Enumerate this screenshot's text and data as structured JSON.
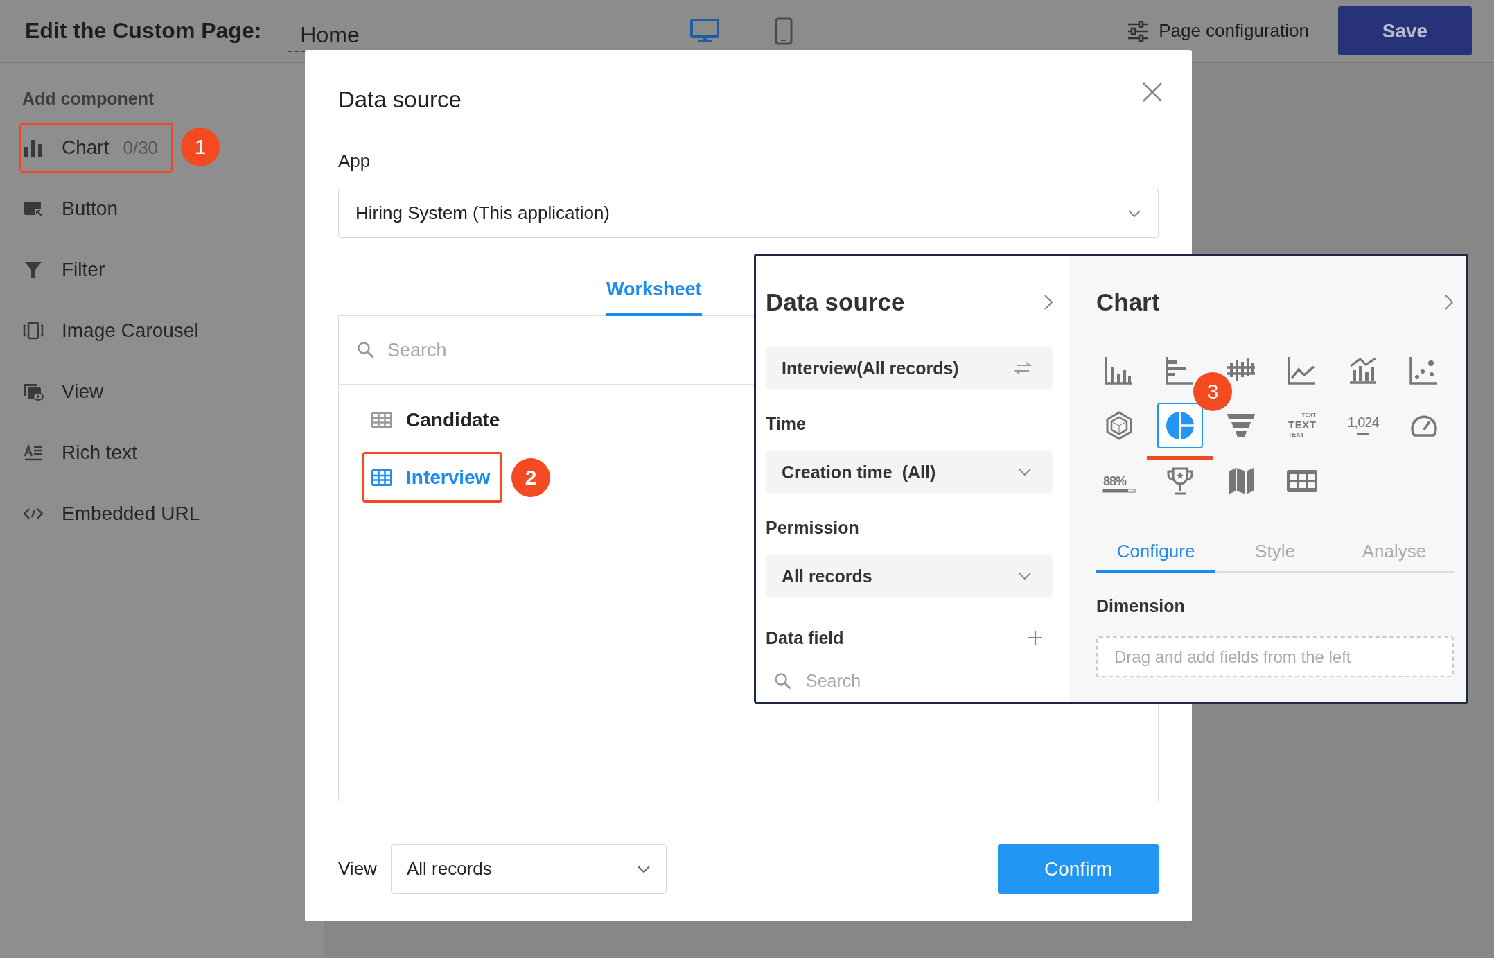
{
  "topbar": {
    "title": "Edit the Custom Page:",
    "page_name": "Home",
    "devices": [
      {
        "kind": "desktop",
        "selected": true
      },
      {
        "kind": "mobile",
        "selected": false
      }
    ],
    "config_label": "Page configuration",
    "save_label": "Save"
  },
  "sidebar": {
    "heading": "Add component",
    "items": [
      {
        "kind": "chart",
        "label": "Chart",
        "count": "0/30",
        "highlighted": true,
        "badge": "1"
      },
      {
        "kind": "button",
        "label": "Button",
        "highlighted": false
      },
      {
        "kind": "filter",
        "label": "Filter",
        "highlighted": false
      },
      {
        "kind": "carousel",
        "label": "Image Carousel",
        "highlighted": false
      },
      {
        "kind": "view",
        "label": "View",
        "highlighted": false
      },
      {
        "kind": "richtext",
        "label": "Rich text",
        "highlighted": false
      },
      {
        "kind": "embed",
        "label": "Embedded URL",
        "highlighted": false
      }
    ]
  },
  "dialog": {
    "title": "Data source",
    "app_label": "App",
    "app_value": "Hiring System (This application)",
    "tabs": [
      {
        "label": "Worksheet",
        "selected": true
      }
    ],
    "search_placeholder": "Search",
    "worksheets": [
      {
        "label": "Candidate",
        "selected": false,
        "highlighted": false
      },
      {
        "label": "Interview",
        "selected": true,
        "highlighted": true,
        "badge": "2"
      }
    ],
    "view_label": "View",
    "view_value": "All records",
    "confirm_label": "Confirm"
  },
  "popup": {
    "data_panel": {
      "title": "Data source",
      "source_value": "Interview(All records)",
      "time_label": "Time",
      "time_value": "Creation time  (All)",
      "permission_label": "Permission",
      "permission_value": "All records",
      "field_label": "Data field",
      "search_placeholder": "Search"
    },
    "chart_panel": {
      "title": "Chart",
      "types": [
        {
          "kind": "column",
          "selected": false
        },
        {
          "kind": "bar",
          "selected": false
        },
        {
          "kind": "bidirectional",
          "selected": false
        },
        {
          "kind": "line",
          "selected": false
        },
        {
          "kind": "combo",
          "selected": false
        },
        {
          "kind": "scatter",
          "selected": false
        },
        {
          "kind": "radar",
          "selected": false
        },
        {
          "kind": "pie",
          "selected": true,
          "badge": "3"
        },
        {
          "kind": "funnel",
          "selected": false
        },
        {
          "kind": "wordcloud",
          "selected": false,
          "texts": [
            "TEXT",
            "TEXT",
            "TEXT"
          ]
        },
        {
          "kind": "number",
          "selected": false,
          "texts": [
            "1,024"
          ]
        },
        {
          "kind": "gauge",
          "selected": false
        },
        {
          "kind": "progress",
          "selected": false,
          "texts": [
            "88%"
          ]
        },
        {
          "kind": "ranking",
          "selected": false
        },
        {
          "kind": "map",
          "selected": false
        },
        {
          "kind": "table",
          "selected": false
        }
      ],
      "tabs": [
        {
          "label": "Configure",
          "selected": true
        },
        {
          "label": "Style",
          "selected": false
        },
        {
          "label": "Analyse",
          "selected": false
        }
      ],
      "dimension_label": "Dimension",
      "dimension_placeholder": "Drag and add fields from the left"
    }
  }
}
